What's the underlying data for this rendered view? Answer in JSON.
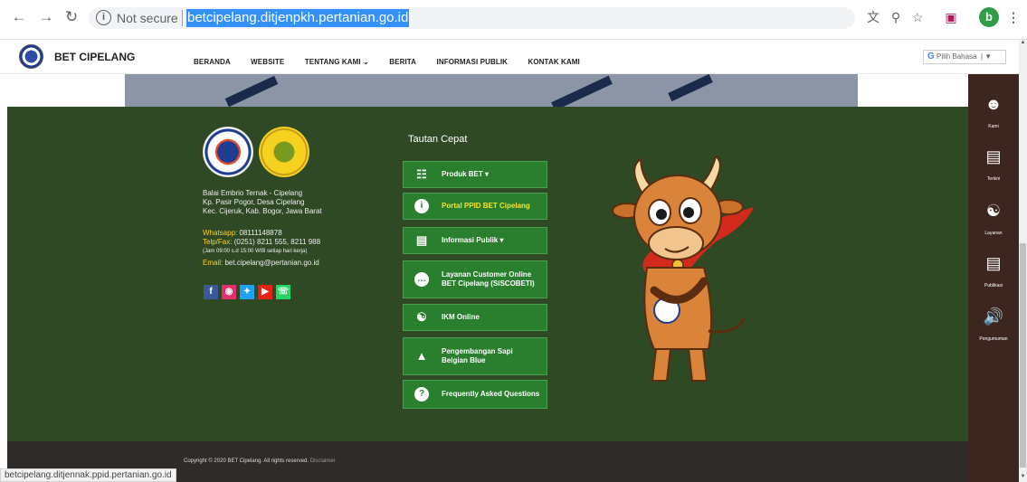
{
  "browser": {
    "not_secure": "Not secure",
    "url": "betcipelang.ditjenpkh.pertanian.go.id",
    "profile_initial": "b"
  },
  "header": {
    "site_title": "BET CIPELANG",
    "menu": [
      "BERANDA",
      "WEBSITE",
      "TENTANG KAMI ⌄",
      "BERITA",
      "INFORMASI PUBLIK",
      "KONTAK KAMI"
    ],
    "translate_label": "Pilih Bahasa"
  },
  "footer": {
    "address": [
      "Balai Embrio Ternak - Cipelang",
      "Kp. Pasir Pogor, Desa Cipelang",
      "Kec. Cijeruk, Kab. Bogor, Jawa Barat"
    ],
    "whatsapp_label": "Whatsapp:",
    "whatsapp": "08111148878",
    "telp_label": "Telp/Fax:",
    "telp": "(0251) 8211 555, 8211 988",
    "hours": "(Jam 09:00 s.d 15:00 WIB setiap hari kerja)",
    "email_label": "Email:",
    "email": "bet.cipelang@pertanian.go.id",
    "quick_links_title": "Tautan Cepat",
    "quick_links": [
      {
        "line1": "Produk BET ▾",
        "line2": "",
        "icon": "basket-icon"
      },
      {
        "line1": "Portal PPID BET Cipelang",
        "line2": "",
        "icon": "info-icon"
      },
      {
        "line1": "Informasi Publik ▾",
        "line2": "",
        "icon": "document-icon"
      },
      {
        "line1": "Layanan Customer Online",
        "line2": "BET Cipelang (SISCOBETI)",
        "icon": "chat-icon"
      },
      {
        "line1": "IKM Online",
        "line2": "",
        "icon": "handshake-icon"
      },
      {
        "line1": "Pengembangan Sapi",
        "line2": "Belgian Blue",
        "icon": "flask-icon"
      },
      {
        "line1": "Frequently Asked Questions",
        "line2": "",
        "icon": "question-icon"
      }
    ]
  },
  "copyright": {
    "text": "Copyright © 2020 BET Cipelang. All rights reserved.",
    "disclaimer": "Disclaimer"
  },
  "status_bar_url": "betcipelang.ditjennak.ppid.pertanian.go.id",
  "sidebar": [
    {
      "label": "Kami",
      "icon": "people-icon"
    },
    {
      "label": "Terkini",
      "icon": "newspaper-icon"
    },
    {
      "label": "Layanan",
      "icon": "handshake-icon"
    },
    {
      "label": "Publikasi",
      "icon": "document-icon"
    },
    {
      "label": "Pengumuman",
      "icon": "megaphone-icon"
    }
  ],
  "colors": {
    "footer_bg": "#2e4924",
    "button_green": "#2a7f2e",
    "sidebar_bg": "#3e2620",
    "highlight_yellow": "#f5e425"
  }
}
